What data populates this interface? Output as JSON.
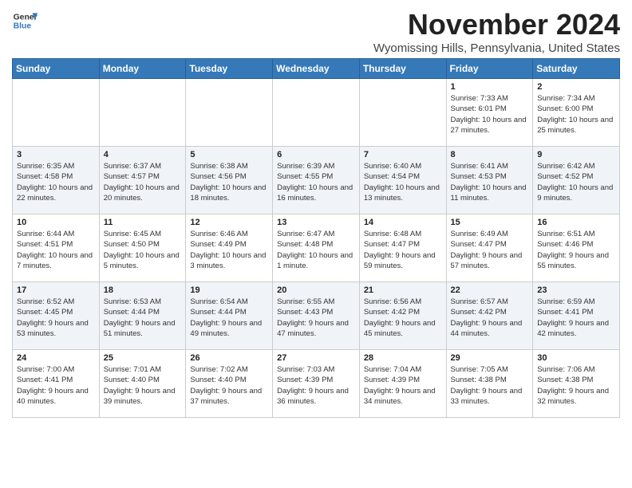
{
  "header": {
    "logo_line1": "General",
    "logo_line2": "Blue",
    "month": "November 2024",
    "location": "Wyomissing Hills, Pennsylvania, United States"
  },
  "days_of_week": [
    "Sunday",
    "Monday",
    "Tuesday",
    "Wednesday",
    "Thursday",
    "Friday",
    "Saturday"
  ],
  "weeks": [
    [
      {
        "day": "",
        "info": ""
      },
      {
        "day": "",
        "info": ""
      },
      {
        "day": "",
        "info": ""
      },
      {
        "day": "",
        "info": ""
      },
      {
        "day": "",
        "info": ""
      },
      {
        "day": "1",
        "info": "Sunrise: 7:33 AM\nSunset: 6:01 PM\nDaylight: 10 hours and 27 minutes."
      },
      {
        "day": "2",
        "info": "Sunrise: 7:34 AM\nSunset: 6:00 PM\nDaylight: 10 hours and 25 minutes."
      }
    ],
    [
      {
        "day": "3",
        "info": "Sunrise: 6:35 AM\nSunset: 4:58 PM\nDaylight: 10 hours and 22 minutes."
      },
      {
        "day": "4",
        "info": "Sunrise: 6:37 AM\nSunset: 4:57 PM\nDaylight: 10 hours and 20 minutes."
      },
      {
        "day": "5",
        "info": "Sunrise: 6:38 AM\nSunset: 4:56 PM\nDaylight: 10 hours and 18 minutes."
      },
      {
        "day": "6",
        "info": "Sunrise: 6:39 AM\nSunset: 4:55 PM\nDaylight: 10 hours and 16 minutes."
      },
      {
        "day": "7",
        "info": "Sunrise: 6:40 AM\nSunset: 4:54 PM\nDaylight: 10 hours and 13 minutes."
      },
      {
        "day": "8",
        "info": "Sunrise: 6:41 AM\nSunset: 4:53 PM\nDaylight: 10 hours and 11 minutes."
      },
      {
        "day": "9",
        "info": "Sunrise: 6:42 AM\nSunset: 4:52 PM\nDaylight: 10 hours and 9 minutes."
      }
    ],
    [
      {
        "day": "10",
        "info": "Sunrise: 6:44 AM\nSunset: 4:51 PM\nDaylight: 10 hours and 7 minutes."
      },
      {
        "day": "11",
        "info": "Sunrise: 6:45 AM\nSunset: 4:50 PM\nDaylight: 10 hours and 5 minutes."
      },
      {
        "day": "12",
        "info": "Sunrise: 6:46 AM\nSunset: 4:49 PM\nDaylight: 10 hours and 3 minutes."
      },
      {
        "day": "13",
        "info": "Sunrise: 6:47 AM\nSunset: 4:48 PM\nDaylight: 10 hours and 1 minute."
      },
      {
        "day": "14",
        "info": "Sunrise: 6:48 AM\nSunset: 4:47 PM\nDaylight: 9 hours and 59 minutes."
      },
      {
        "day": "15",
        "info": "Sunrise: 6:49 AM\nSunset: 4:47 PM\nDaylight: 9 hours and 57 minutes."
      },
      {
        "day": "16",
        "info": "Sunrise: 6:51 AM\nSunset: 4:46 PM\nDaylight: 9 hours and 55 minutes."
      }
    ],
    [
      {
        "day": "17",
        "info": "Sunrise: 6:52 AM\nSunset: 4:45 PM\nDaylight: 9 hours and 53 minutes."
      },
      {
        "day": "18",
        "info": "Sunrise: 6:53 AM\nSunset: 4:44 PM\nDaylight: 9 hours and 51 minutes."
      },
      {
        "day": "19",
        "info": "Sunrise: 6:54 AM\nSunset: 4:44 PM\nDaylight: 9 hours and 49 minutes."
      },
      {
        "day": "20",
        "info": "Sunrise: 6:55 AM\nSunset: 4:43 PM\nDaylight: 9 hours and 47 minutes."
      },
      {
        "day": "21",
        "info": "Sunrise: 6:56 AM\nSunset: 4:42 PM\nDaylight: 9 hours and 45 minutes."
      },
      {
        "day": "22",
        "info": "Sunrise: 6:57 AM\nSunset: 4:42 PM\nDaylight: 9 hours and 44 minutes."
      },
      {
        "day": "23",
        "info": "Sunrise: 6:59 AM\nSunset: 4:41 PM\nDaylight: 9 hours and 42 minutes."
      }
    ],
    [
      {
        "day": "24",
        "info": "Sunrise: 7:00 AM\nSunset: 4:41 PM\nDaylight: 9 hours and 40 minutes."
      },
      {
        "day": "25",
        "info": "Sunrise: 7:01 AM\nSunset: 4:40 PM\nDaylight: 9 hours and 39 minutes."
      },
      {
        "day": "26",
        "info": "Sunrise: 7:02 AM\nSunset: 4:40 PM\nDaylight: 9 hours and 37 minutes."
      },
      {
        "day": "27",
        "info": "Sunrise: 7:03 AM\nSunset: 4:39 PM\nDaylight: 9 hours and 36 minutes."
      },
      {
        "day": "28",
        "info": "Sunrise: 7:04 AM\nSunset: 4:39 PM\nDaylight: 9 hours and 34 minutes."
      },
      {
        "day": "29",
        "info": "Sunrise: 7:05 AM\nSunset: 4:38 PM\nDaylight: 9 hours and 33 minutes."
      },
      {
        "day": "30",
        "info": "Sunrise: 7:06 AM\nSunset: 4:38 PM\nDaylight: 9 hours and 32 minutes."
      }
    ]
  ]
}
